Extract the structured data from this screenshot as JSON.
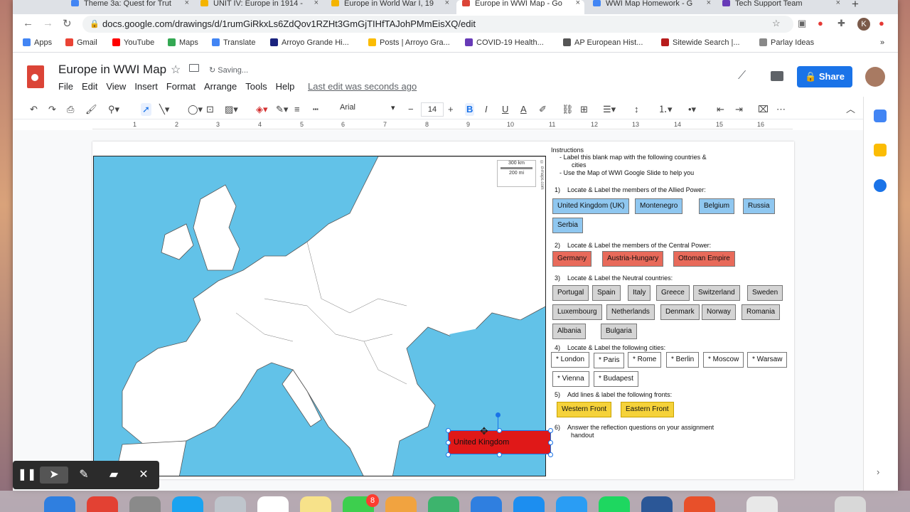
{
  "browser": {
    "tabs": [
      {
        "label": "Theme 3a: Quest for Trut",
        "color": "#4285f4"
      },
      {
        "label": "UNIT IV: Europe in 1914 -",
        "color": "#f4b400"
      },
      {
        "label": "Europe in World War I, 19",
        "color": "#f4b400"
      },
      {
        "label": "Europe in WWI Map - Go",
        "color": "#db4437"
      },
      {
        "label": "WWI Map Homework - G",
        "color": "#4285f4"
      },
      {
        "label": "Tech Support Team",
        "color": "#673ab7"
      }
    ],
    "url": "docs.google.com/drawings/d/1rumGiRkxLs6ZdQov1RZHt3GmGjTIHfTAJohPMmEisXQ/edit",
    "profile_initial": "K",
    "bookmarks": [
      {
        "label": "Apps",
        "color": "#4285f4"
      },
      {
        "label": "Gmail",
        "color": "#ea4335"
      },
      {
        "label": "YouTube",
        "color": "#ff0000"
      },
      {
        "label": "Maps",
        "color": "#34a853"
      },
      {
        "label": "Translate",
        "color": "#4285f4"
      },
      {
        "label": "Arroyo Grande Hi...",
        "color": "#1a237e"
      },
      {
        "label": "Posts | Arroyo Gra...",
        "color": "#fbbc04"
      },
      {
        "label": "COVID-19 Health...",
        "color": "#673ab7"
      },
      {
        "label": "AP European Hist...",
        "color": "#555555"
      },
      {
        "label": "Sitewide Search |...",
        "color": "#b71c1c"
      },
      {
        "label": "Parlay Ideas",
        "color": "#888888"
      }
    ]
  },
  "doc": {
    "title": "Europe in WWI Map",
    "status": "Saving...",
    "menu": [
      "File",
      "Edit",
      "View",
      "Insert",
      "Format",
      "Arrange",
      "Tools",
      "Help"
    ],
    "last_edit": "Last edit was seconds ago",
    "share_label": "Share"
  },
  "toolbar": {
    "font": "Arial",
    "size": "14"
  },
  "ruler": [
    "1",
    "2",
    "3",
    "4",
    "5",
    "6",
    "7",
    "8",
    "9",
    "10",
    "11",
    "12",
    "13",
    "14",
    "15",
    "16"
  ],
  "map": {
    "scale_km": "300 km",
    "scale_mi": "200 mi",
    "credit": "© d-maps.com"
  },
  "selected_box": {
    "text": "United Kingdom",
    "color": "#e01818"
  },
  "instructions": {
    "heading": "Instructions",
    "lines": [
      "Label this blank map with the following countries &",
      "cities",
      "Use the Map of WWI Google Slide to help you"
    ],
    "steps": [
      {
        "n": "1)",
        "text": "Locate &  Label the members of the Allied Power:"
      },
      {
        "n": "2)",
        "text": "Locate & Label the members of the Central Power:"
      },
      {
        "n": "3)",
        "text": "Locate & Label the Neutral countries:"
      },
      {
        "n": "4)",
        "text": "Locate & Label the following cities:"
      },
      {
        "n": "5)",
        "text": "Add lines & label the following fronts:"
      },
      {
        "n": "6)",
        "text": "Answer the reflection questions on your assignment"
      }
    ],
    "step6b": "handout",
    "allied": [
      "United Kingdom (UK)",
      "Montenegro",
      "Belgium",
      "Russia",
      "Serbia"
    ],
    "central": [
      "Germany",
      "Austria-Hungary",
      "Ottoman Empire"
    ],
    "neutral": [
      "Portugal",
      "Spain",
      "Italy",
      "Greece",
      "Switzerland",
      "Sweden",
      "Luxembourg",
      "Netherlands",
      "Denmark",
      "Norway",
      "Romania",
      "Albania",
      "Bulgaria"
    ],
    "cities": [
      "* London",
      "* Paris",
      "* Rome",
      "* Berlin",
      "* Moscow",
      "* Warsaw",
      "* Vienna",
      "* Budapest"
    ],
    "fronts": [
      "Western Front",
      "Eastern Front"
    ]
  },
  "dock_badge": "8",
  "colors": {
    "sea": "#62c2e8",
    "allied": "#8fc7f0",
    "central": "#e86a5a",
    "neutral": "#d4d4d4",
    "front": "#f5d23a",
    "accent": "#1a73e8"
  }
}
